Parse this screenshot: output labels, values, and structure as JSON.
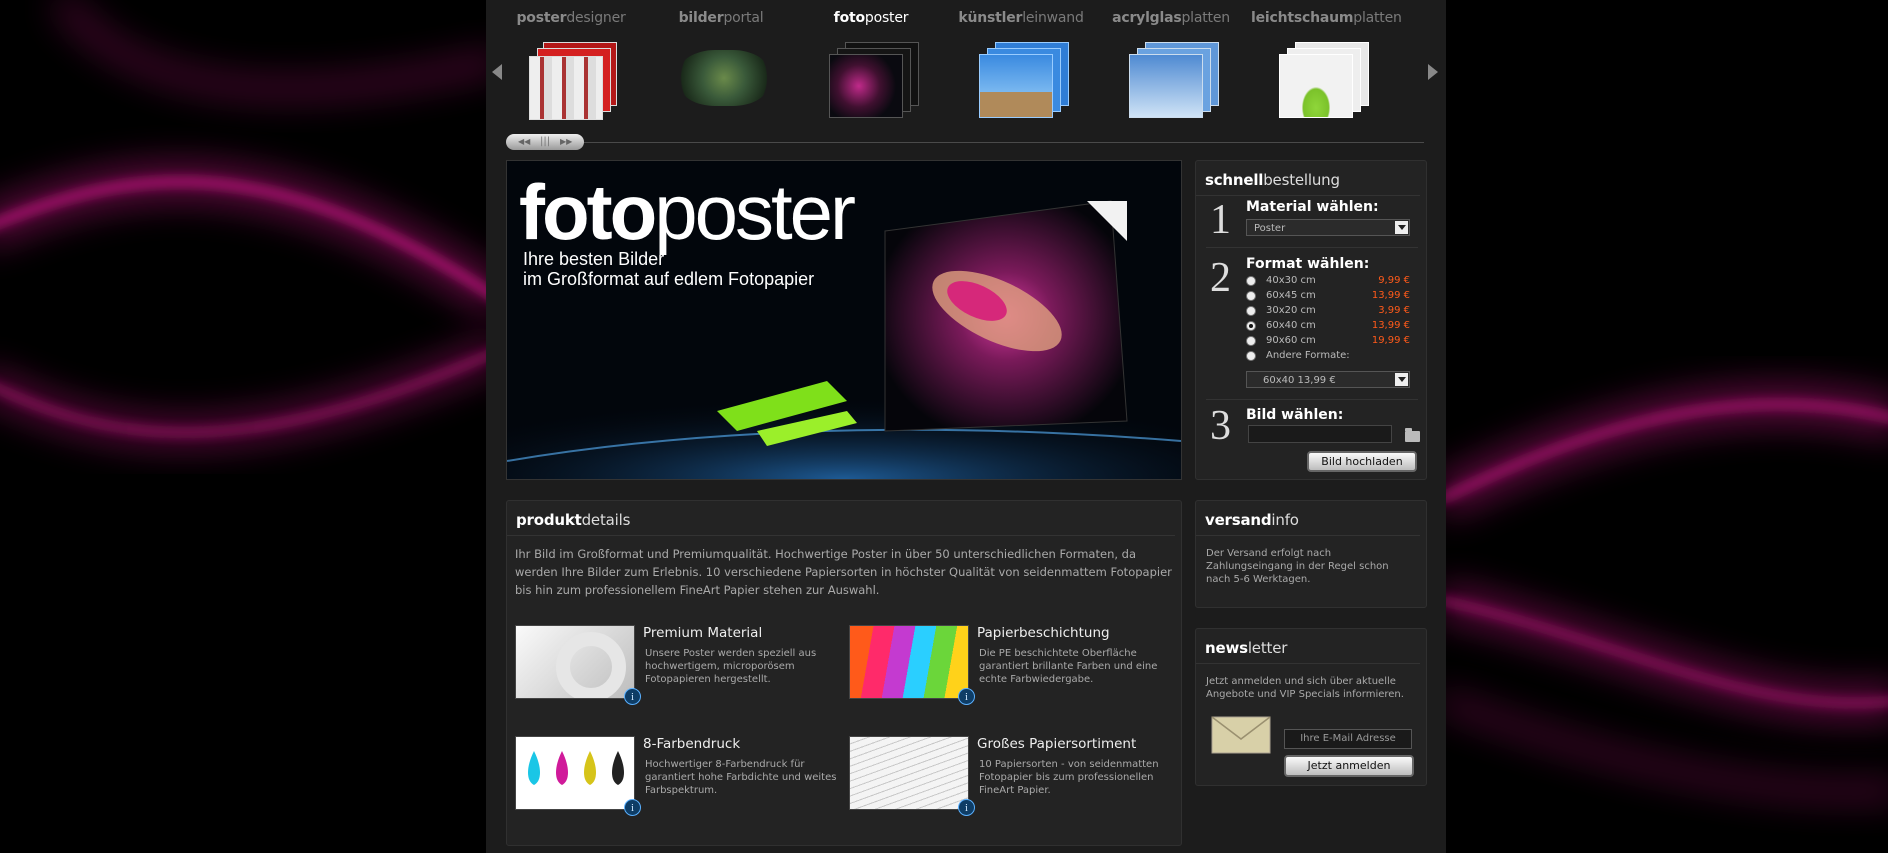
{
  "nav": {
    "categories": [
      {
        "bold": "poster",
        "rest": "designer",
        "active": false
      },
      {
        "bold": "bilder",
        "rest": "portal",
        "active": false
      },
      {
        "bold": "foto",
        "rest": "poster",
        "active": true
      },
      {
        "bold": "künstler",
        "rest": "leinwand",
        "active": false
      },
      {
        "bold": "acrylglas",
        "rest": "platten",
        "active": false
      },
      {
        "bold": "leichtschaum",
        "rest": "platten",
        "active": false
      }
    ],
    "scroller_left": "◀◀",
    "scroller_right": "▶▶"
  },
  "hero": {
    "title_bold": "foto",
    "title_rest": "poster",
    "subtitle_line1": "Ihre besten Bilder",
    "subtitle_line2": "im Großformat auf edlem Fotopapier"
  },
  "order": {
    "title_bold": "schnell",
    "title_rest": "bestellung",
    "step1_number": "1",
    "step1_label": "Material wählen:",
    "material_selected": "Poster",
    "step2_number": "2",
    "step2_label": "Format wählen:",
    "formats": [
      {
        "name": "40x30 cm",
        "price": "9,99 €",
        "checked": false
      },
      {
        "name": "60x45 cm",
        "price": "13,99 €",
        "checked": false
      },
      {
        "name": "30x20 cm",
        "price": "3,99 €",
        "checked": false
      },
      {
        "name": "60x40 cm",
        "price": "13,99 €",
        "checked": true
      },
      {
        "name": "90x60 cm",
        "price": "19,99 €",
        "checked": false
      },
      {
        "name": "Andere Formate:",
        "price": "",
        "checked": false
      }
    ],
    "format_selected": "60x40 13,99 €",
    "step3_number": "3",
    "step3_label": "Bild wählen:",
    "upload_button": "Bild hochladen"
  },
  "details": {
    "title_bold": "produkt",
    "title_rest": "details",
    "text": "Ihr Bild im Großformat und Premiumqualität. Hochwertige Poster in über 50 unterschiedlichen Formaten, da werden Ihre Bilder zum Erlebnis. 10 verschiedene Papiersorten in höchster Qualität von seidenmattem Fotopapier bis hin zum professionellem FineArt Papier stehen zur Auswahl.",
    "features": [
      {
        "title": "Premium Material",
        "desc": "Unsere Poster werden speziell aus hochwertigem, microporösem Fotopapieren hergestellt."
      },
      {
        "title": "Papierbeschichtung",
        "desc": "Die PE beschichtete Oberfläche garantiert brillante Farben und eine echte Farbwiedergabe."
      },
      {
        "title": "8-Farbendruck",
        "desc": "Hochwertiger 8-Farbendruck für garantiert hohe Farbdichte und weites Farbspektrum."
      },
      {
        "title": "Großes Papiersortiment",
        "desc": "10 Papiersorten - von seidenmatten Fotopapier bis zum professionellen FineArt Papier."
      }
    ],
    "info_glyph": "i"
  },
  "shipping": {
    "title_bold": "versand",
    "title_rest": "info",
    "text": "Der Versand erfolgt nach Zahlungseingang in der Regel schon nach 5-6 Werktagen."
  },
  "newsletter": {
    "title_bold": "news",
    "title_rest": "letter",
    "text": "Jetzt anmelden und sich über aktuelle Angebote und VIP Specials informieren.",
    "email_placeholder": "Ihre E-Mail Adresse",
    "submit_label": "Jetzt anmelden"
  },
  "colors": {
    "price": "#ff5a1a",
    "background_streaks": "#ff1aa8",
    "info_icon": "#5ab0ff"
  }
}
